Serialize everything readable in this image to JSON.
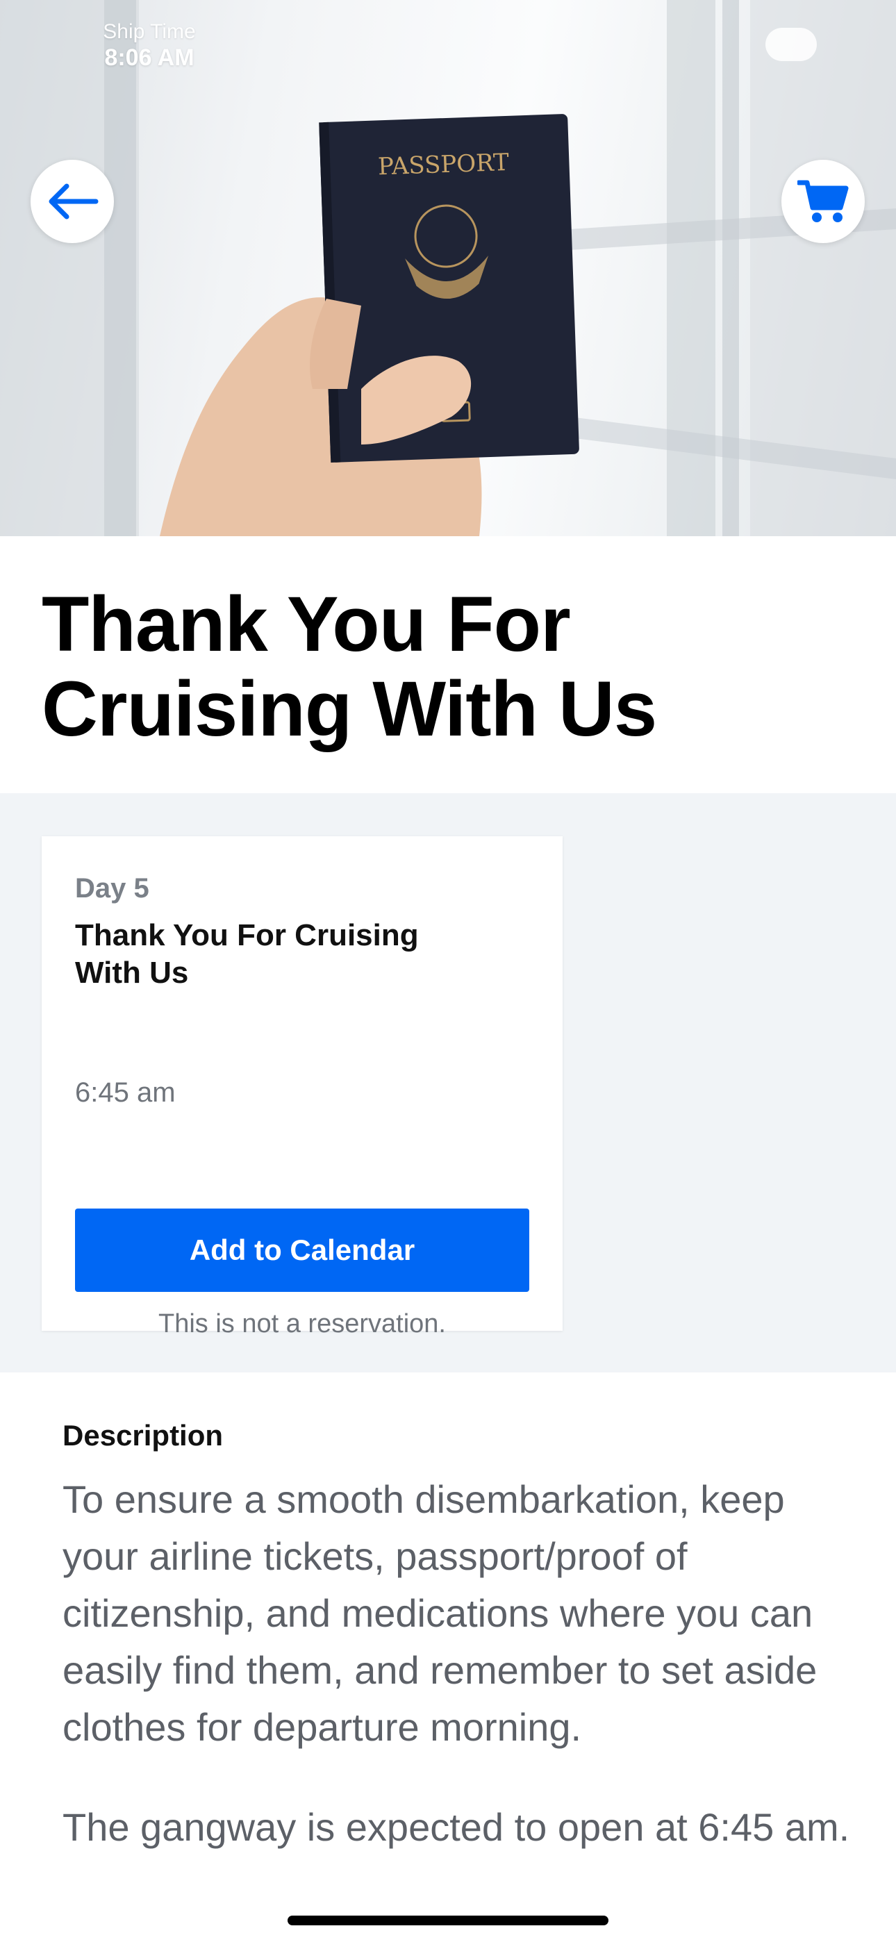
{
  "status": {
    "ship_time_label": "Ship Time",
    "ship_time": "8:06 AM"
  },
  "header": {
    "back_icon": "arrow-left-icon",
    "cart_icon": "shopping-cart-icon",
    "hero_image": "hand holding passport photo",
    "passport_text": "PASSPORT",
    "accent_color": "#0067f4"
  },
  "page": {
    "title": "Thank You For Cruising With Us"
  },
  "event_card": {
    "day": "Day 5",
    "title": "Thank You For Cruising With Us",
    "time": "6:45 am",
    "button_label": "Add to Calendar",
    "note": "This is not a reservation."
  },
  "description": {
    "heading": "Description",
    "paragraph1": "To ensure a smooth disembarkation, keep your airline tickets, passport/proof of citizenship, and medications where you can easily find them, and remember to set aside clothes for departure morning.",
    "paragraph2": "The gangway is expected to open at 6:45 am."
  }
}
